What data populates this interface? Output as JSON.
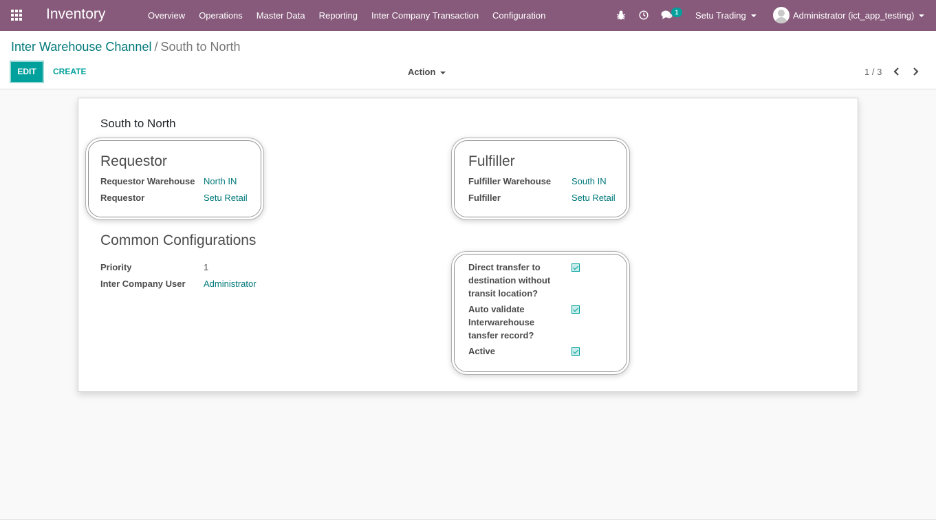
{
  "navbar": {
    "app_name": "Inventory",
    "menu": [
      "Overview",
      "Operations",
      "Master Data",
      "Reporting",
      "Inter Company Transaction",
      "Configuration"
    ],
    "messages_count": "1",
    "company": "Setu Trading",
    "user": "Administrator (ict_app_testing)",
    "color": "#875a7b"
  },
  "control_panel": {
    "breadcrumb_parent": "Inter Warehouse Channel",
    "breadcrumb_separator": "/",
    "breadcrumb_current": "South to North",
    "edit_label": "EDIT",
    "create_label": "CREATE",
    "action_label": "Action",
    "pager": "1 / 3"
  },
  "form": {
    "title": "South to North",
    "requestor": {
      "heading": "Requestor",
      "warehouse_label": "Requestor Warehouse",
      "warehouse_value": "North IN",
      "requestor_label": "Requestor",
      "requestor_value": "Setu Retail"
    },
    "fulfiller": {
      "heading": "Fulfiller",
      "warehouse_label": "Fulfiller Warehouse",
      "warehouse_value": "South IN",
      "fulfiller_label": "Fulfiller",
      "fulfiller_value": "Setu Retail"
    },
    "common": {
      "heading": "Common Configurations",
      "priority_label": "Priority",
      "priority_value": "1",
      "user_label": "Inter Company User",
      "user_value": "Administrator"
    },
    "options": {
      "direct_transfer_label_1": "Direct transfer to",
      "direct_transfer_label_2": "destination without",
      "direct_transfer_label_3": "transit location?",
      "direct_transfer_checked": true,
      "auto_validate_label_1": "Auto validate",
      "auto_validate_label_2": "Interwarehouse",
      "auto_validate_label_3": "tansfer record?",
      "auto_validate_checked": true,
      "active_label": "Active",
      "active_checked": true
    }
  },
  "accent_color": "#00a09d",
  "link_color": "#00787a"
}
